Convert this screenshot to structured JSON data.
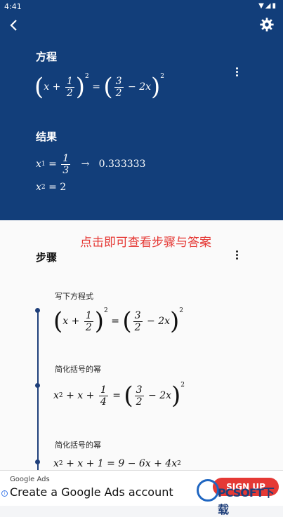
{
  "status_bar": {
    "time": "4:41",
    "icons": "wifi-icon signal-icon battery-icon"
  },
  "colors": {
    "header_bg": "#123e7a",
    "accent_red": "#e53935",
    "timeline": "#1f3f7a"
  },
  "equation_section": {
    "title": "方程",
    "lhs": {
      "var": "x",
      "plus": "+",
      "num": "1",
      "den": "2",
      "exp": "2"
    },
    "equals": "=",
    "rhs": {
      "num": "3",
      "den": "2",
      "minus": "−",
      "term": "2x",
      "exp": "2"
    }
  },
  "result_section": {
    "title": "结果",
    "x1_label": "x",
    "x1_sub": "1",
    "x1_eq": "=",
    "x1_num": "1",
    "x1_den": "3",
    "arrow": "→",
    "x1_decimal": "0.333333",
    "x2_label": "x",
    "x2_sub": "2",
    "x2_eq": "=",
    "x2_value": "2"
  },
  "hint": "点击即可查看步骤与答案",
  "steps_section": {
    "title": "步骤",
    "steps": [
      {
        "label": "写下方程式"
      },
      {
        "label": "简化括号的幂"
      },
      {
        "label": "简化括号的幂"
      }
    ]
  },
  "ad": {
    "provider": "Google Ads",
    "headline": "Create a Google Ads account",
    "cta": "SIGN UP"
  },
  "watermark": {
    "text": "PCSOFT下载"
  }
}
